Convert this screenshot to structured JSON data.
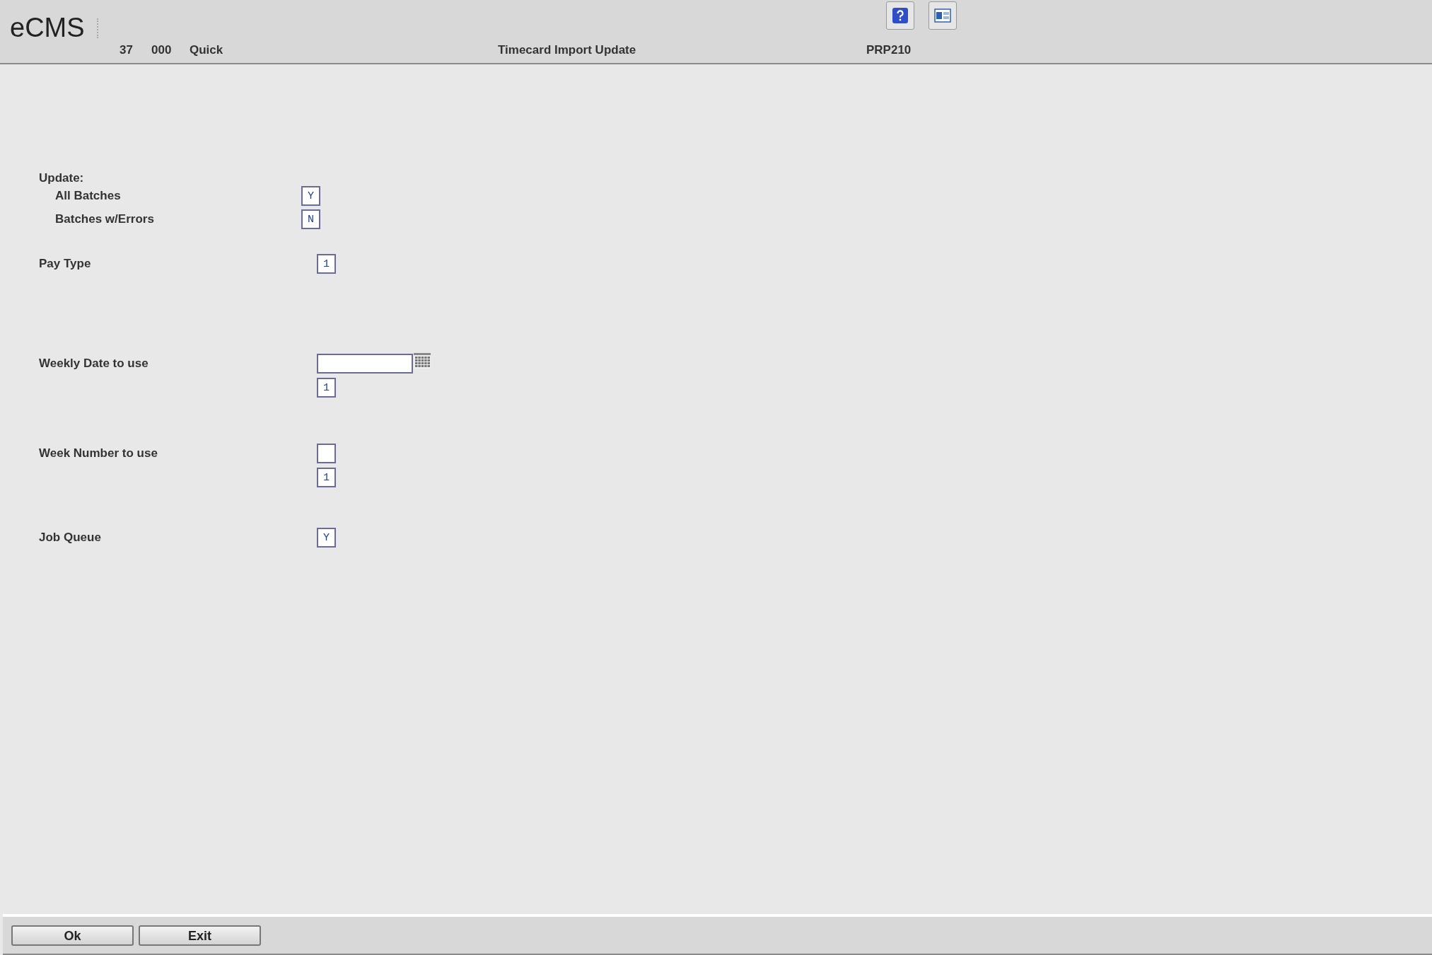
{
  "header": {
    "logo": "eCMS",
    "company": "37",
    "division": "000",
    "user": "Quick",
    "title": "Timecard Import Update",
    "program": "PRP210"
  },
  "groups": [
    {
      "heading": "Update:",
      "rows": [
        {
          "label": "All Batches",
          "inputs": [
            {
              "kind": "text",
              "value": "Y"
            }
          ]
        },
        {
          "label": "Batches w/Errors",
          "inputs": [
            {
              "kind": "text",
              "value": "N"
            }
          ]
        }
      ]
    },
    {
      "rows": [
        {
          "label": "Pay Type",
          "inputs": [
            {
              "kind": "text",
              "value": "1"
            }
          ]
        }
      ]
    },
    {
      "rows": [
        {
          "label": "Weekly Date to use",
          "inputs": [
            {
              "kind": "date"
            },
            {
              "kind": "text",
              "value": "1"
            }
          ]
        }
      ]
    },
    {
      "rows": [
        {
          "label": "Week Number to use",
          "inputs": [
            {
              "kind": "text"
            },
            {
              "kind": "text",
              "value": "1"
            }
          ]
        }
      ]
    },
    {
      "rows": [
        {
          "label": "Job Queue",
          "inputs": [
            {
              "kind": "text",
              "value": "Y"
            }
          ]
        }
      ]
    }
  ],
  "buttons": [
    "Ok",
    "Exit"
  ]
}
